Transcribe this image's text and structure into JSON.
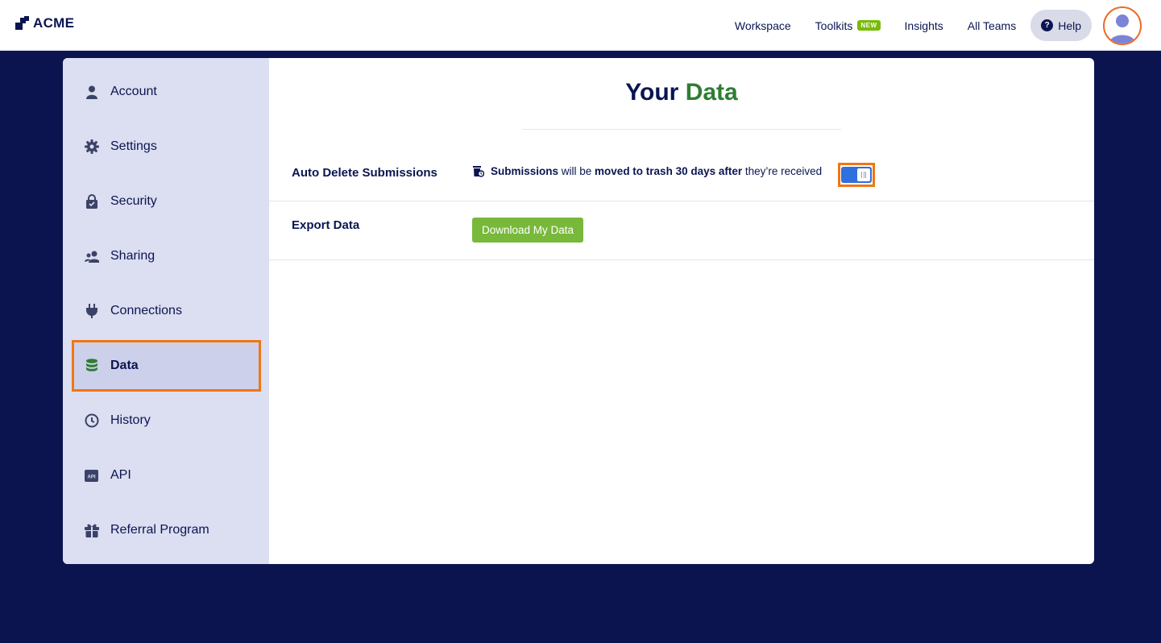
{
  "header": {
    "logo_text": "ACME",
    "nav": [
      {
        "label": "Workspace"
      },
      {
        "label": "Toolkits",
        "badge": "NEW"
      },
      {
        "label": "Insights"
      },
      {
        "label": "All Teams"
      }
    ],
    "help_label": "Help"
  },
  "sidebar": {
    "items": [
      {
        "label": "Account",
        "icon": "user-icon"
      },
      {
        "label": "Settings",
        "icon": "gear-icon"
      },
      {
        "label": "Security",
        "icon": "lock-icon"
      },
      {
        "label": "Sharing",
        "icon": "users-icon"
      },
      {
        "label": "Connections",
        "icon": "plug-icon"
      },
      {
        "label": "Data",
        "icon": "database-icon",
        "active": true
      },
      {
        "label": "History",
        "icon": "history-icon"
      },
      {
        "label": "API",
        "icon": "api-icon"
      },
      {
        "label": "Referral Program",
        "icon": "gift-icon"
      }
    ]
  },
  "main": {
    "title_part1": "Your ",
    "title_part2": "Data",
    "auto_delete": {
      "label": "Auto Delete Submissions",
      "desc_bold1": "Submissions",
      "desc_text1": " will be ",
      "desc_bold2": "moved to trash 30 days after",
      "desc_text2": " they’re received",
      "toggle_on": true
    },
    "export": {
      "label": "Export Data",
      "button_label": "Download My Data"
    }
  },
  "colors": {
    "navy": "#0a1551",
    "background": "#0c1450",
    "green_title": "#2d7e32",
    "button_green": "#78b83a",
    "toggle_blue": "#2f6fde",
    "highlight_orange": "#f07615",
    "sidebar_bg": "#dcdef1"
  }
}
